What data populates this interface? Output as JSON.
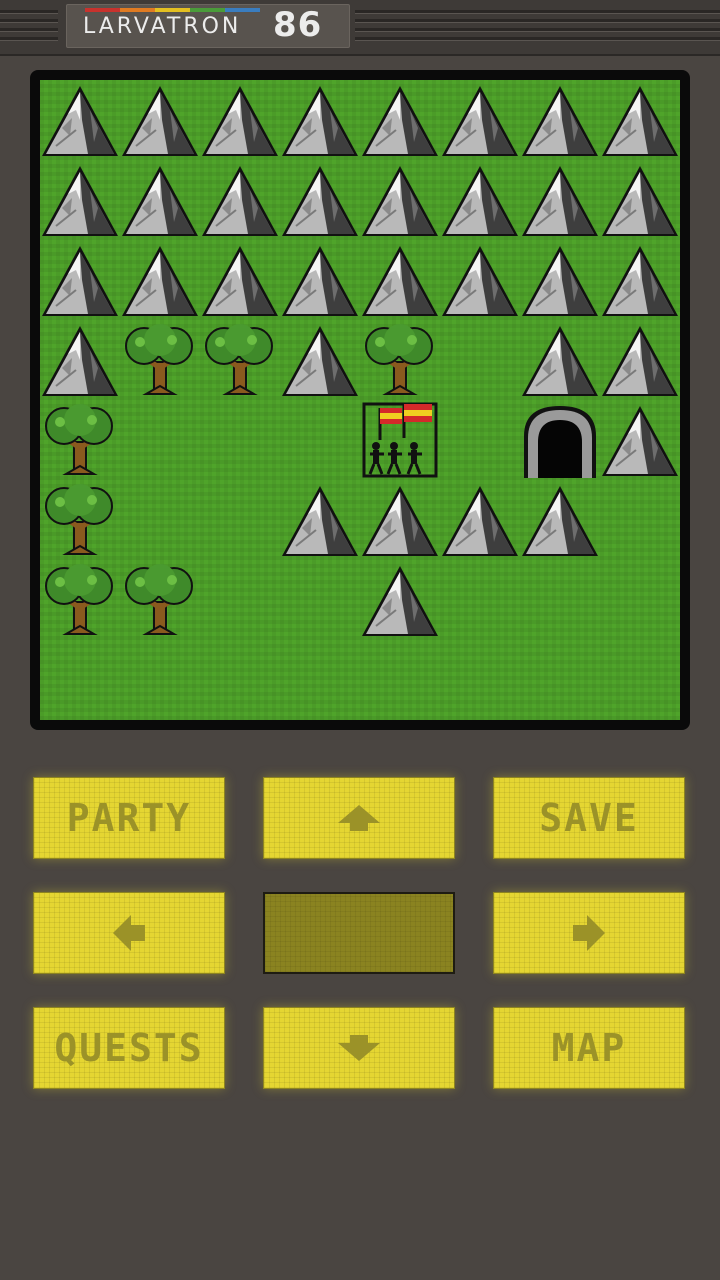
{
  "header": {
    "brand": "LARVATRON",
    "model": "86",
    "rainbow_colors": [
      "#c8322d",
      "#e07b22",
      "#e4c021",
      "#4a9c3a",
      "#3a7dbf"
    ]
  },
  "map": {
    "cols": 8,
    "rows": 8,
    "legend": {
      "M": "mountain",
      "T": "tree",
      "G": "grass",
      "C": "cave-entrance",
      "P": "party"
    },
    "grid": [
      "MMMMMMMM",
      "MMMMMMMM",
      "MMMMMMMM",
      "MTTMTGMM",
      "TGGGPGCM",
      "TGGMMMMG",
      "TTGGMGGG",
      "GGGGGGGG"
    ],
    "colors": {
      "grass": "#4fa42a",
      "tree_foliage": "#3f8a2a",
      "trunk": "#8a5a1e",
      "mountain_light": "#bfbfbf",
      "mountain_dark": "#3b3b3b"
    }
  },
  "controls": {
    "party_label": "PARTY",
    "save_label": "SAVE",
    "quests_label": "QUESTS",
    "map_label": "MAP",
    "up_icon": "arrow-up-icon",
    "down_icon": "arrow-down-icon",
    "left_icon": "arrow-left-icon",
    "right_icon": "arrow-right-icon",
    "button_color": "#e5d632",
    "label_color": "#9b9228"
  }
}
